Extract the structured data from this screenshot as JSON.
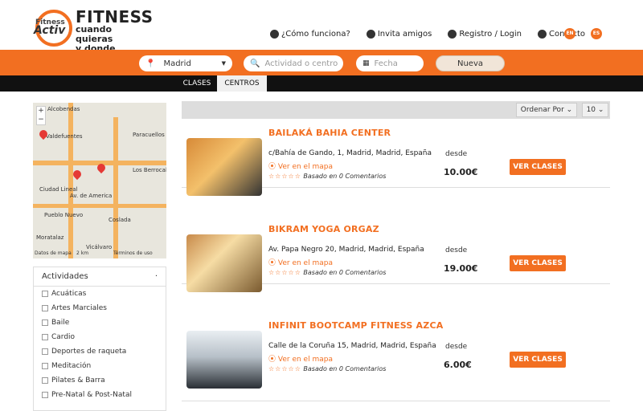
{
  "header": {
    "logo_small": "Fitness",
    "logo_actv": "Activ",
    "logo_title": "FITNESS",
    "logo_tagline": "cuando quieras\ny donde quieras",
    "nav": [
      {
        "label": "¿Cómo funciona?",
        "icon": "question-icon"
      },
      {
        "label": "Invita amigos",
        "icon": "friends-icon"
      },
      {
        "label": "Registro / Login",
        "icon": "lock-icon"
      },
      {
        "label": "Contacto",
        "icon": "contact-icon"
      }
    ],
    "languages": [
      "EN",
      "ES"
    ]
  },
  "search": {
    "city": "Madrid",
    "activity_placeholder": "Actividad o centro",
    "date_placeholder": "Fecha",
    "new_search": "Nueva búsqueda"
  },
  "tabs": [
    {
      "label": "CLASES",
      "active": false
    },
    {
      "label": "CENTROS",
      "active": true
    }
  ],
  "map": {
    "labels": [
      "Alcobendas",
      "Valdefuentes",
      "Paracuellos de Jarama",
      "Los Berrocales del Jarama",
      "Ciudad Lineal",
      "Pueblo Nuevo",
      "Coslada",
      "Moratalaz",
      "Av. de America",
      "Vicálvaro"
    ],
    "footer": [
      "Datos de mapa",
      "2 km",
      "Términos de uso"
    ]
  },
  "filters": {
    "title": "Actividades",
    "items": [
      "Acuáticas",
      "Artes Marciales",
      "Baile",
      "Cardio",
      "Deportes de raqueta",
      "Meditación",
      "Pilates & Barra",
      "Pre-Natal & Post-Natal"
    ]
  },
  "sort": {
    "order_label": "Ordenar Por",
    "page_size": "10"
  },
  "results": [
    {
      "name": "BAILAKÁ BAHIA CENTER",
      "address": "c/Bahía de Gando, 1, Madrid, Madrid, España",
      "map_link": "Ver en el mapa",
      "rating_text": "Basado en 0 Comentarios",
      "from_label": "desde",
      "price": "10.00€",
      "button": "VER CLASES"
    },
    {
      "name": "BIKRAM YOGA ORGAZ",
      "address": "Av. Papa Negro 20, Madrid, Madrid, España",
      "map_link": "Ver en el mapa",
      "rating_text": "Basado en 0 Comentarios",
      "from_label": "desde",
      "price": "19.00€",
      "button": "VER CLASES"
    },
    {
      "name": "INFINIT BOOTCAMP FITNESS AZCA",
      "address": "Calle de la Coruña 15, Madrid, Madrid, España",
      "map_link": "Ver en el mapa",
      "rating_text": "Basado en 0 Comentarios",
      "from_label": "desde",
      "price": "6.00€",
      "button": "VER CLASES"
    }
  ],
  "colors": {
    "accent": "#f26f21",
    "nav_black": "#111111"
  }
}
